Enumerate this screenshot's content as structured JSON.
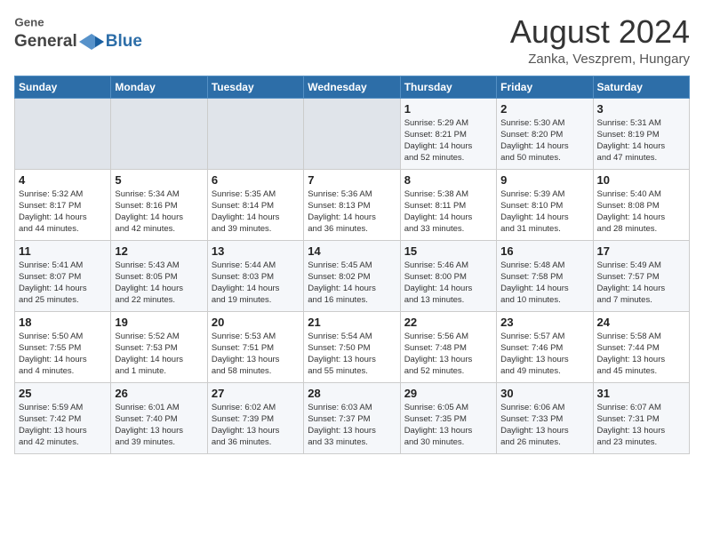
{
  "header": {
    "logo_general": "General",
    "logo_blue": "Blue",
    "month_year": "August 2024",
    "location": "Zanka, Veszprem, Hungary"
  },
  "days_of_week": [
    "Sunday",
    "Monday",
    "Tuesday",
    "Wednesday",
    "Thursday",
    "Friday",
    "Saturday"
  ],
  "weeks": [
    [
      {
        "day": "",
        "info": ""
      },
      {
        "day": "",
        "info": ""
      },
      {
        "day": "",
        "info": ""
      },
      {
        "day": "",
        "info": ""
      },
      {
        "day": "1",
        "info": "Sunrise: 5:29 AM\nSunset: 8:21 PM\nDaylight: 14 hours\nand 52 minutes."
      },
      {
        "day": "2",
        "info": "Sunrise: 5:30 AM\nSunset: 8:20 PM\nDaylight: 14 hours\nand 50 minutes."
      },
      {
        "day": "3",
        "info": "Sunrise: 5:31 AM\nSunset: 8:19 PM\nDaylight: 14 hours\nand 47 minutes."
      }
    ],
    [
      {
        "day": "4",
        "info": "Sunrise: 5:32 AM\nSunset: 8:17 PM\nDaylight: 14 hours\nand 44 minutes."
      },
      {
        "day": "5",
        "info": "Sunrise: 5:34 AM\nSunset: 8:16 PM\nDaylight: 14 hours\nand 42 minutes."
      },
      {
        "day": "6",
        "info": "Sunrise: 5:35 AM\nSunset: 8:14 PM\nDaylight: 14 hours\nand 39 minutes."
      },
      {
        "day": "7",
        "info": "Sunrise: 5:36 AM\nSunset: 8:13 PM\nDaylight: 14 hours\nand 36 minutes."
      },
      {
        "day": "8",
        "info": "Sunrise: 5:38 AM\nSunset: 8:11 PM\nDaylight: 14 hours\nand 33 minutes."
      },
      {
        "day": "9",
        "info": "Sunrise: 5:39 AM\nSunset: 8:10 PM\nDaylight: 14 hours\nand 31 minutes."
      },
      {
        "day": "10",
        "info": "Sunrise: 5:40 AM\nSunset: 8:08 PM\nDaylight: 14 hours\nand 28 minutes."
      }
    ],
    [
      {
        "day": "11",
        "info": "Sunrise: 5:41 AM\nSunset: 8:07 PM\nDaylight: 14 hours\nand 25 minutes."
      },
      {
        "day": "12",
        "info": "Sunrise: 5:43 AM\nSunset: 8:05 PM\nDaylight: 14 hours\nand 22 minutes."
      },
      {
        "day": "13",
        "info": "Sunrise: 5:44 AM\nSunset: 8:03 PM\nDaylight: 14 hours\nand 19 minutes."
      },
      {
        "day": "14",
        "info": "Sunrise: 5:45 AM\nSunset: 8:02 PM\nDaylight: 14 hours\nand 16 minutes."
      },
      {
        "day": "15",
        "info": "Sunrise: 5:46 AM\nSunset: 8:00 PM\nDaylight: 14 hours\nand 13 minutes."
      },
      {
        "day": "16",
        "info": "Sunrise: 5:48 AM\nSunset: 7:58 PM\nDaylight: 14 hours\nand 10 minutes."
      },
      {
        "day": "17",
        "info": "Sunrise: 5:49 AM\nSunset: 7:57 PM\nDaylight: 14 hours\nand 7 minutes."
      }
    ],
    [
      {
        "day": "18",
        "info": "Sunrise: 5:50 AM\nSunset: 7:55 PM\nDaylight: 14 hours\nand 4 minutes."
      },
      {
        "day": "19",
        "info": "Sunrise: 5:52 AM\nSunset: 7:53 PM\nDaylight: 14 hours\nand 1 minute."
      },
      {
        "day": "20",
        "info": "Sunrise: 5:53 AM\nSunset: 7:51 PM\nDaylight: 13 hours\nand 58 minutes."
      },
      {
        "day": "21",
        "info": "Sunrise: 5:54 AM\nSunset: 7:50 PM\nDaylight: 13 hours\nand 55 minutes."
      },
      {
        "day": "22",
        "info": "Sunrise: 5:56 AM\nSunset: 7:48 PM\nDaylight: 13 hours\nand 52 minutes."
      },
      {
        "day": "23",
        "info": "Sunrise: 5:57 AM\nSunset: 7:46 PM\nDaylight: 13 hours\nand 49 minutes."
      },
      {
        "day": "24",
        "info": "Sunrise: 5:58 AM\nSunset: 7:44 PM\nDaylight: 13 hours\nand 45 minutes."
      }
    ],
    [
      {
        "day": "25",
        "info": "Sunrise: 5:59 AM\nSunset: 7:42 PM\nDaylight: 13 hours\nand 42 minutes."
      },
      {
        "day": "26",
        "info": "Sunrise: 6:01 AM\nSunset: 7:40 PM\nDaylight: 13 hours\nand 39 minutes."
      },
      {
        "day": "27",
        "info": "Sunrise: 6:02 AM\nSunset: 7:39 PM\nDaylight: 13 hours\nand 36 minutes."
      },
      {
        "day": "28",
        "info": "Sunrise: 6:03 AM\nSunset: 7:37 PM\nDaylight: 13 hours\nand 33 minutes."
      },
      {
        "day": "29",
        "info": "Sunrise: 6:05 AM\nSunset: 7:35 PM\nDaylight: 13 hours\nand 30 minutes."
      },
      {
        "day": "30",
        "info": "Sunrise: 6:06 AM\nSunset: 7:33 PM\nDaylight: 13 hours\nand 26 minutes."
      },
      {
        "day": "31",
        "info": "Sunrise: 6:07 AM\nSunset: 7:31 PM\nDaylight: 13 hours\nand 23 minutes."
      }
    ]
  ]
}
